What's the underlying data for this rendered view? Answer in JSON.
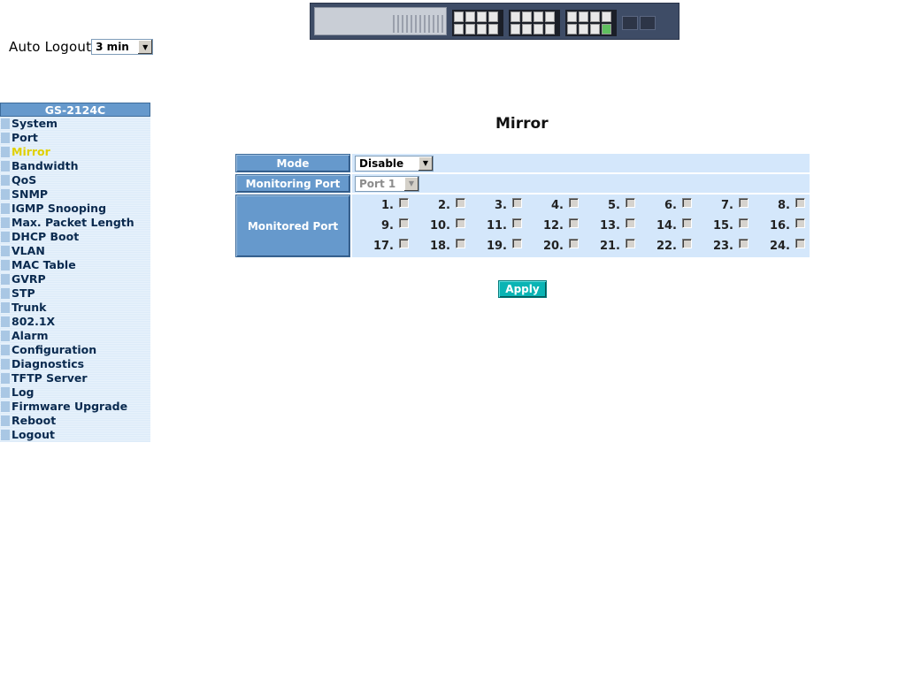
{
  "header": {
    "auto_logout_label": "Auto Logout",
    "auto_logout_value": "3 min"
  },
  "sidebar": {
    "title": "GS-2124C",
    "items": [
      {
        "label": "System"
      },
      {
        "label": "Port"
      },
      {
        "label": "Mirror",
        "active": true
      },
      {
        "label": "Bandwidth"
      },
      {
        "label": "QoS"
      },
      {
        "label": "SNMP"
      },
      {
        "label": "IGMP Snooping"
      },
      {
        "label": "Max. Packet Length"
      },
      {
        "label": "DHCP Boot"
      },
      {
        "label": "VLAN"
      },
      {
        "label": "MAC Table"
      },
      {
        "label": "GVRP"
      },
      {
        "label": "STP"
      },
      {
        "label": "Trunk"
      },
      {
        "label": "802.1X"
      },
      {
        "label": "Alarm"
      },
      {
        "label": "Configuration"
      },
      {
        "label": "Diagnostics"
      },
      {
        "label": "TFTP Server"
      },
      {
        "label": "Log"
      },
      {
        "label": "Firmware Upgrade"
      },
      {
        "label": "Reboot"
      },
      {
        "label": "Logout"
      }
    ]
  },
  "main": {
    "title": "Mirror",
    "mode_label": "Mode",
    "mode_value": "Disable",
    "monitoring_port_label": "Monitoring Port",
    "monitoring_port_value": "Port 1",
    "monitored_port_label": "Monitored Port",
    "ports": [
      "1.",
      "2.",
      "3.",
      "4.",
      "5.",
      "6.",
      "7.",
      "8.",
      "9.",
      "10.",
      "11.",
      "12.",
      "13.",
      "14.",
      "15.",
      "16.",
      "17.",
      "18.",
      "19.",
      "20.",
      "21.",
      "22.",
      "23.",
      "24."
    ],
    "apply_label": "Apply"
  },
  "colors": {
    "header_blue": "#6699cc",
    "row_bg": "#d4e7fb",
    "active_menu": "#e0d000",
    "apply_bg": "#0ab4b4"
  }
}
